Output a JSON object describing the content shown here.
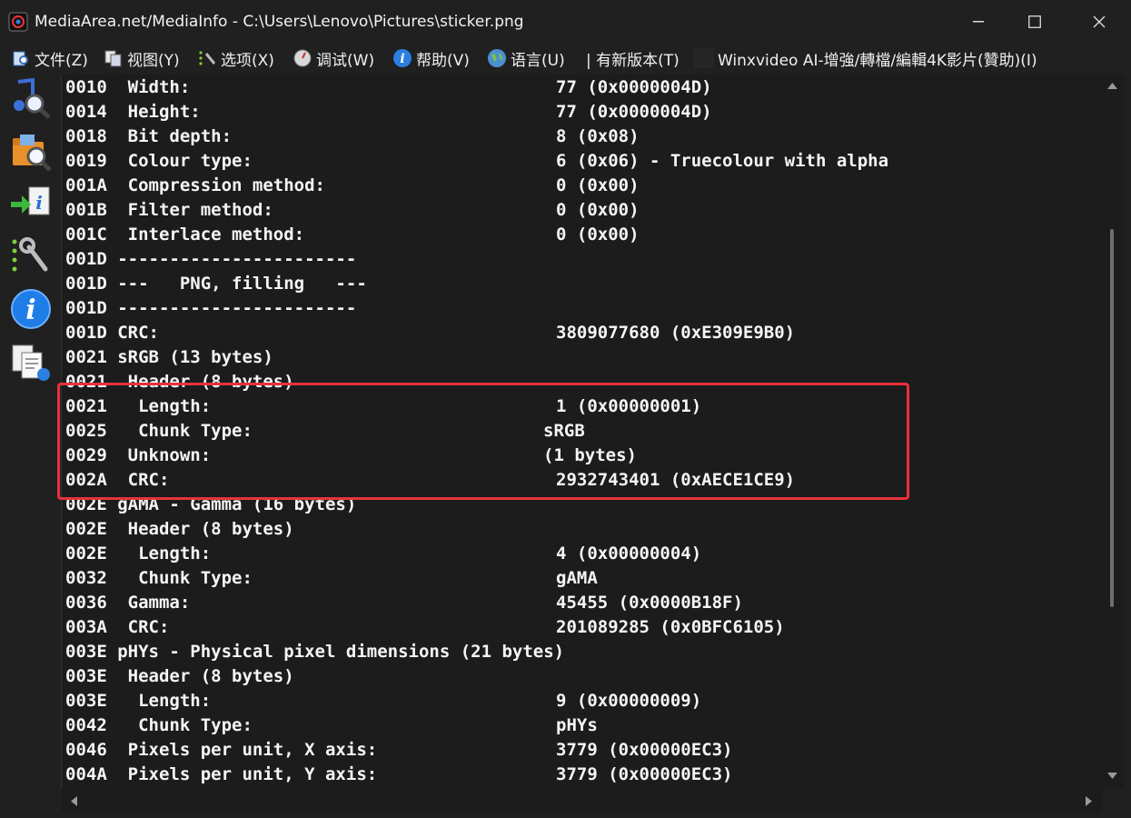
{
  "window": {
    "title": "MediaArea.net/MediaInfo - C:\\Users\\Lenovo\\Pictures\\sticker.png",
    "minimize_glyph": "—",
    "maximize_glyph": "☐",
    "close_glyph": "✕"
  },
  "menu": [
    {
      "label": "文件(Z)",
      "icon": "file-open-icon"
    },
    {
      "label": "视图(Y)",
      "icon": "view-icon"
    },
    {
      "label": "选项(X)",
      "icon": "options-wrench-icon"
    },
    {
      "label": "调试(W)",
      "icon": "debug-icon"
    },
    {
      "label": "帮助(V)",
      "icon": "help-info-icon"
    },
    {
      "label": "语言(U)",
      "icon": "language-globe-icon"
    },
    {
      "label": "| 有新版本(T)",
      "icon": ""
    },
    {
      "label": "Winxvideo AI-增強/轉檔/編輯4K影片(贊助)(I)",
      "icon": "sponsor-icon"
    }
  ],
  "sidebar": [
    {
      "name": "open-file-icon"
    },
    {
      "name": "open-folder-icon"
    },
    {
      "name": "export-info-icon"
    },
    {
      "name": "preferences-icon"
    },
    {
      "name": "about-info-icon"
    },
    {
      "name": "view-report-icon"
    }
  ],
  "lines": [
    {
      "off": "0010",
      "text": "Width:",
      "indent": 1,
      "value": "77 (0x0000004D)"
    },
    {
      "off": "0014",
      "text": "Height:",
      "indent": 1,
      "value": "77 (0x0000004D)"
    },
    {
      "off": "0018",
      "text": "Bit depth:",
      "indent": 1,
      "value": "8 (0x08)"
    },
    {
      "off": "0019",
      "text": "Colour type:",
      "indent": 1,
      "value": "6 (0x06) - Truecolour with alpha"
    },
    {
      "off": "001A",
      "text": "Compression method:",
      "indent": 1,
      "value": "0 (0x00)"
    },
    {
      "off": "001B",
      "text": "Filter method:",
      "indent": 1,
      "value": "0 (0x00)"
    },
    {
      "off": "001C",
      "text": "Interlace method:",
      "indent": 1,
      "value": "0 (0x00)"
    },
    {
      "off": "001D",
      "text": "-----------------------",
      "indent": 0,
      "value": ""
    },
    {
      "off": "001D",
      "text": "---   PNG, filling   ---",
      "indent": 0,
      "value": ""
    },
    {
      "off": "001D",
      "text": "-----------------------",
      "indent": 0,
      "value": ""
    },
    {
      "off": "001D",
      "text": "CRC:",
      "indent": 0,
      "value": "3809077680 (0xE309E9B0)"
    },
    {
      "off": "0021",
      "text": "sRGB (13 bytes)",
      "indent": 0,
      "value": ""
    },
    {
      "off": "0021",
      "text": "Header (8 bytes)",
      "indent": 1,
      "value": ""
    },
    {
      "off": "0021",
      "text": "Length:",
      "indent": 2,
      "value": "1 (0x00000001)"
    },
    {
      "off": "0025",
      "text": "Chunk Type:",
      "indent": 2,
      "value": "sRGB"
    },
    {
      "off": "0029",
      "text": "Unknown:",
      "indent": 1,
      "value": "(1 bytes)"
    },
    {
      "off": "002A",
      "text": "CRC:",
      "indent": 1,
      "value": "2932743401 (0xAECE1CE9)"
    },
    {
      "off": "002E",
      "text": "gAMA - Gamma (16 bytes)",
      "indent": 0,
      "value": ""
    },
    {
      "off": "002E",
      "text": "Header (8 bytes)",
      "indent": 1,
      "value": ""
    },
    {
      "off": "002E",
      "text": "Length:",
      "indent": 2,
      "value": "4 (0x00000004)"
    },
    {
      "off": "0032",
      "text": "Chunk Type:",
      "indent": 2,
      "value": "gAMA"
    },
    {
      "off": "0036",
      "text": "Gamma:",
      "indent": 1,
      "value": "45455 (0x0000B18F)"
    },
    {
      "off": "003A",
      "text": "CRC:",
      "indent": 1,
      "value": "201089285 (0x0BFC6105)"
    },
    {
      "off": "003E",
      "text": "pHYs - Physical pixel dimensions (21 bytes)",
      "indent": 0,
      "value": ""
    },
    {
      "off": "003E",
      "text": "Header (8 bytes)",
      "indent": 1,
      "value": ""
    },
    {
      "off": "003E",
      "text": "Length:",
      "indent": 2,
      "value": "9 (0x00000009)"
    },
    {
      "off": "0042",
      "text": "Chunk Type:",
      "indent": 2,
      "value": "pHYs"
    },
    {
      "off": "0046",
      "text": "Pixels per unit, X axis:",
      "indent": 1,
      "value": "3779 (0x00000EC3)"
    },
    {
      "off": "004A",
      "text": "Pixels per unit, Y axis:",
      "indent": 1,
      "value": "3779 (0x00000EC3)"
    }
  ],
  "value_indent_overrides": {
    "Chunk Type:": true,
    "Unknown:": true
  },
  "colors": {
    "highlight_border": "#e8323b",
    "background": "#1c1c1c",
    "text": "#f5f5f5"
  }
}
